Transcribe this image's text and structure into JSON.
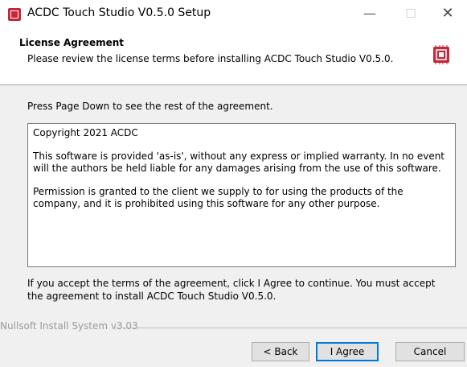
{
  "window": {
    "title": "ACDC Touch Studio V0.5.0 Setup",
    "minimize_glyph": "—",
    "maximize_glyph": "☐",
    "close_glyph": "✕"
  },
  "header": {
    "title": "License Agreement",
    "subtitle": "Please review the license terms before installing ACDC Touch Studio V0.5.0.",
    "logo_icon": "chip-icon"
  },
  "intro": "Press Page Down to see the rest of the agreement.",
  "license": {
    "paragraphs": [
      "Copyright 2021 ACDC",
      "This software is provided 'as-is', without any express or implied warranty. In no event will the authors be held liable for any damages arising from the use of this software.",
      "Permission is granted to the client we supply to for using the products of the company, and it is prohibited using this software for any other purpose."
    ]
  },
  "accept_text": "If you accept the terms of the agreement, click I Agree to continue. You must accept the agreement to install ACDC Touch Studio V0.5.0.",
  "footer": {
    "brand": "Nullsoft Install System v3.03"
  },
  "buttons": {
    "back": "< Back",
    "agree": "I Agree",
    "cancel": "Cancel"
  },
  "colors": {
    "brand_red": "#c6283a",
    "focus_blue": "#0078d7"
  }
}
